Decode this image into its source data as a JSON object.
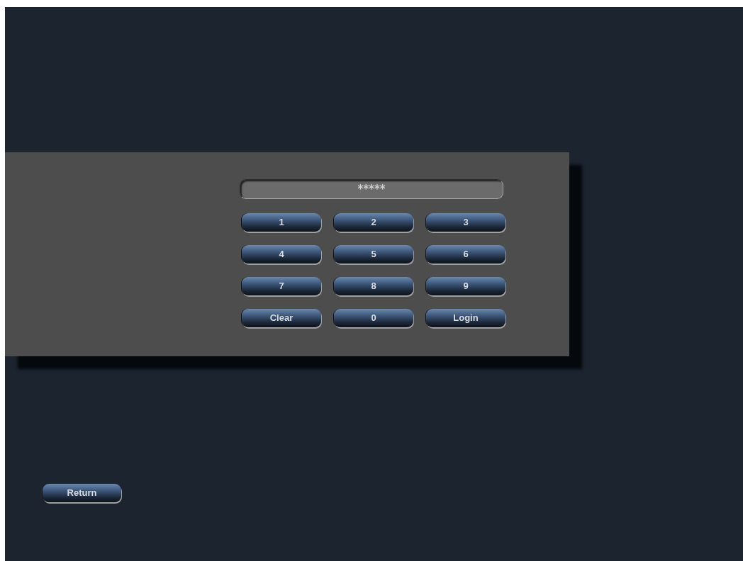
{
  "password_field": {
    "value": "*****"
  },
  "keypad": [
    {
      "label": "1"
    },
    {
      "label": "2"
    },
    {
      "label": "3"
    },
    {
      "label": "4"
    },
    {
      "label": "5"
    },
    {
      "label": "6"
    },
    {
      "label": "7"
    },
    {
      "label": "8"
    },
    {
      "label": "9"
    },
    {
      "label": "Clear"
    },
    {
      "label": "0"
    },
    {
      "label": "Login"
    }
  ],
  "return_button": {
    "label": "Return"
  }
}
